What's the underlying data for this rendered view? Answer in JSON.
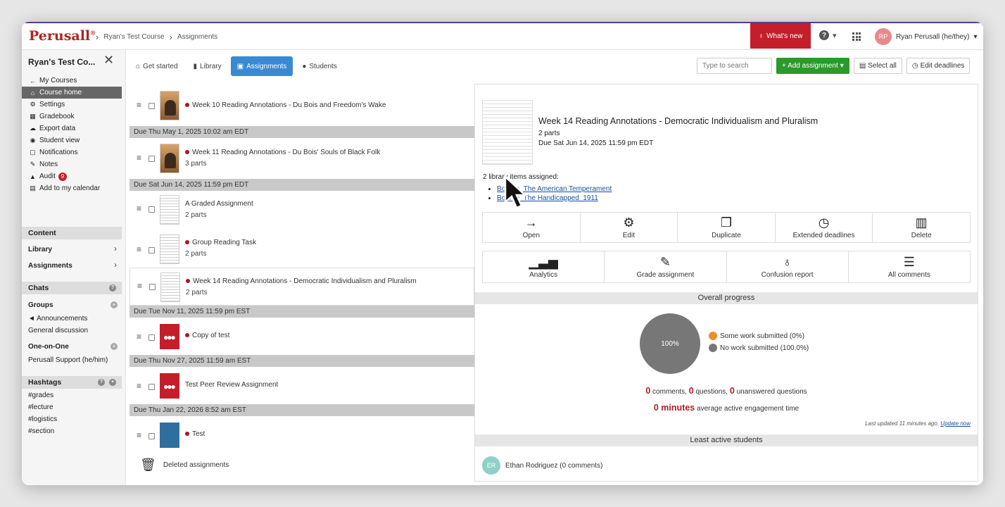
{
  "header": {
    "logo": "Perusall",
    "logo_mark": "®",
    "breadcrumb": [
      "Ryan's Test Course",
      "Assignments"
    ],
    "whats_new": "What's new",
    "help": "?",
    "user_initials": "RP",
    "user_name": "Ryan Perusall (he/they)"
  },
  "sidebar": {
    "course_title": "Ryan's Test Co...",
    "items": [
      {
        "icon": "arrow-left-icon",
        "label": "My Courses"
      },
      {
        "icon": "home-icon",
        "label": "Course home"
      },
      {
        "icon": "gear-icon",
        "label": "Settings"
      },
      {
        "icon": "gradebook-icon",
        "label": "Gradebook"
      },
      {
        "icon": "cloud-download-icon",
        "label": "Export data"
      },
      {
        "icon": "eye-icon",
        "label": "Student view"
      },
      {
        "icon": "bell-icon",
        "label": "Notifications"
      },
      {
        "icon": "pencil-icon",
        "label": "Notes"
      },
      {
        "icon": "warning-icon",
        "label": "Audit"
      },
      {
        "icon": "calendar-icon",
        "label": "Add to my calendar"
      }
    ],
    "audit_count": "9",
    "content_header": "Content",
    "library": "Library",
    "assignments": "Assignments",
    "chats_header": "Chats",
    "groups_header": "Groups",
    "announcements": "Announcements",
    "general_discussion": "General discussion",
    "one_on_one": "One-on-One",
    "support": "Perusall Support (he/him)",
    "hashtags_header": "Hashtags",
    "hashtags": [
      "#grades",
      "#lecture",
      "#logistics",
      "#section"
    ]
  },
  "tabs": [
    "Get started",
    "Library",
    "Assignments",
    "Students"
  ],
  "toolbar": {
    "search_placeholder": "Type to search",
    "add": "+ Add assignment",
    "select_all": "Select all",
    "edit_deadlines": "Edit deadlines"
  },
  "list": {
    "rows": [
      {
        "title": "Week 10 Reading Annotations - Du Bois and Freedom's Wake",
        "sub": ""
      },
      {
        "title": "Week 11 Reading Annotations - Du Bois' Souls of Black Folk",
        "sub": "3 parts"
      },
      {
        "title": "A Graded Assignment",
        "sub": "2 parts"
      },
      {
        "title": "Group Reading Task",
        "sub": "2 parts"
      },
      {
        "title": "Week 14 Reading Annotations - Democratic Individualism and Pluralism",
        "sub": "2 parts"
      },
      {
        "title": "Copy of test",
        "sub": ""
      },
      {
        "title": "Test Peer Review Assignment",
        "sub": ""
      },
      {
        "title": "Test",
        "sub": ""
      }
    ],
    "dues": [
      "Due Thu May 1, 2025 10:02 am EDT",
      "Due Sat Jun 14, 2025 11:59 pm EDT",
      "Due Tue Nov 11, 2025 11:59 pm EST",
      "Due Thu Nov 27, 2025 11:59 am EST",
      "Due Thu Jan 22, 2026 8:52 am EST"
    ],
    "deleted": "Deleted assignments"
  },
  "detail": {
    "title": "Week 14 Reading Annotations - Democratic Individualism and Pluralism",
    "parts": "2 parts",
    "due": "Due Sat Jun 14, 2025 11:59 pm EDT",
    "library_label": "2 library items assigned:",
    "links": [
      "Bourne_The American Temperament",
      "Bourne_The Handicapped_1911"
    ],
    "actions": [
      "Open",
      "Edit",
      "Duplicate",
      "Extended deadlines",
      "Delete"
    ],
    "actions2": [
      "Analytics",
      "Grade assignment",
      "Confusion report",
      "All comments"
    ],
    "overall_progress": "Overall progress",
    "pie_label": "100%",
    "legend": [
      {
        "label": "Some work submitted (0%)",
        "color": "#f28c28"
      },
      {
        "label": "No work submitted (100.0%)",
        "color": "#777777"
      }
    ],
    "comments": "0",
    "comments_label": " comments, ",
    "questions": "0",
    "questions_label": " questions, ",
    "unanswered": "0",
    "unanswered_label": " unanswered questions",
    "minutes": "0 minutes",
    "engagement_label": " average active engagement time",
    "updated": "Last updated 11 minutes ago.",
    "update_now": "Update now",
    "least_active": "Least active students",
    "student_initials": "ER",
    "student": "Ethan Rodriguez (0 comments)"
  }
}
